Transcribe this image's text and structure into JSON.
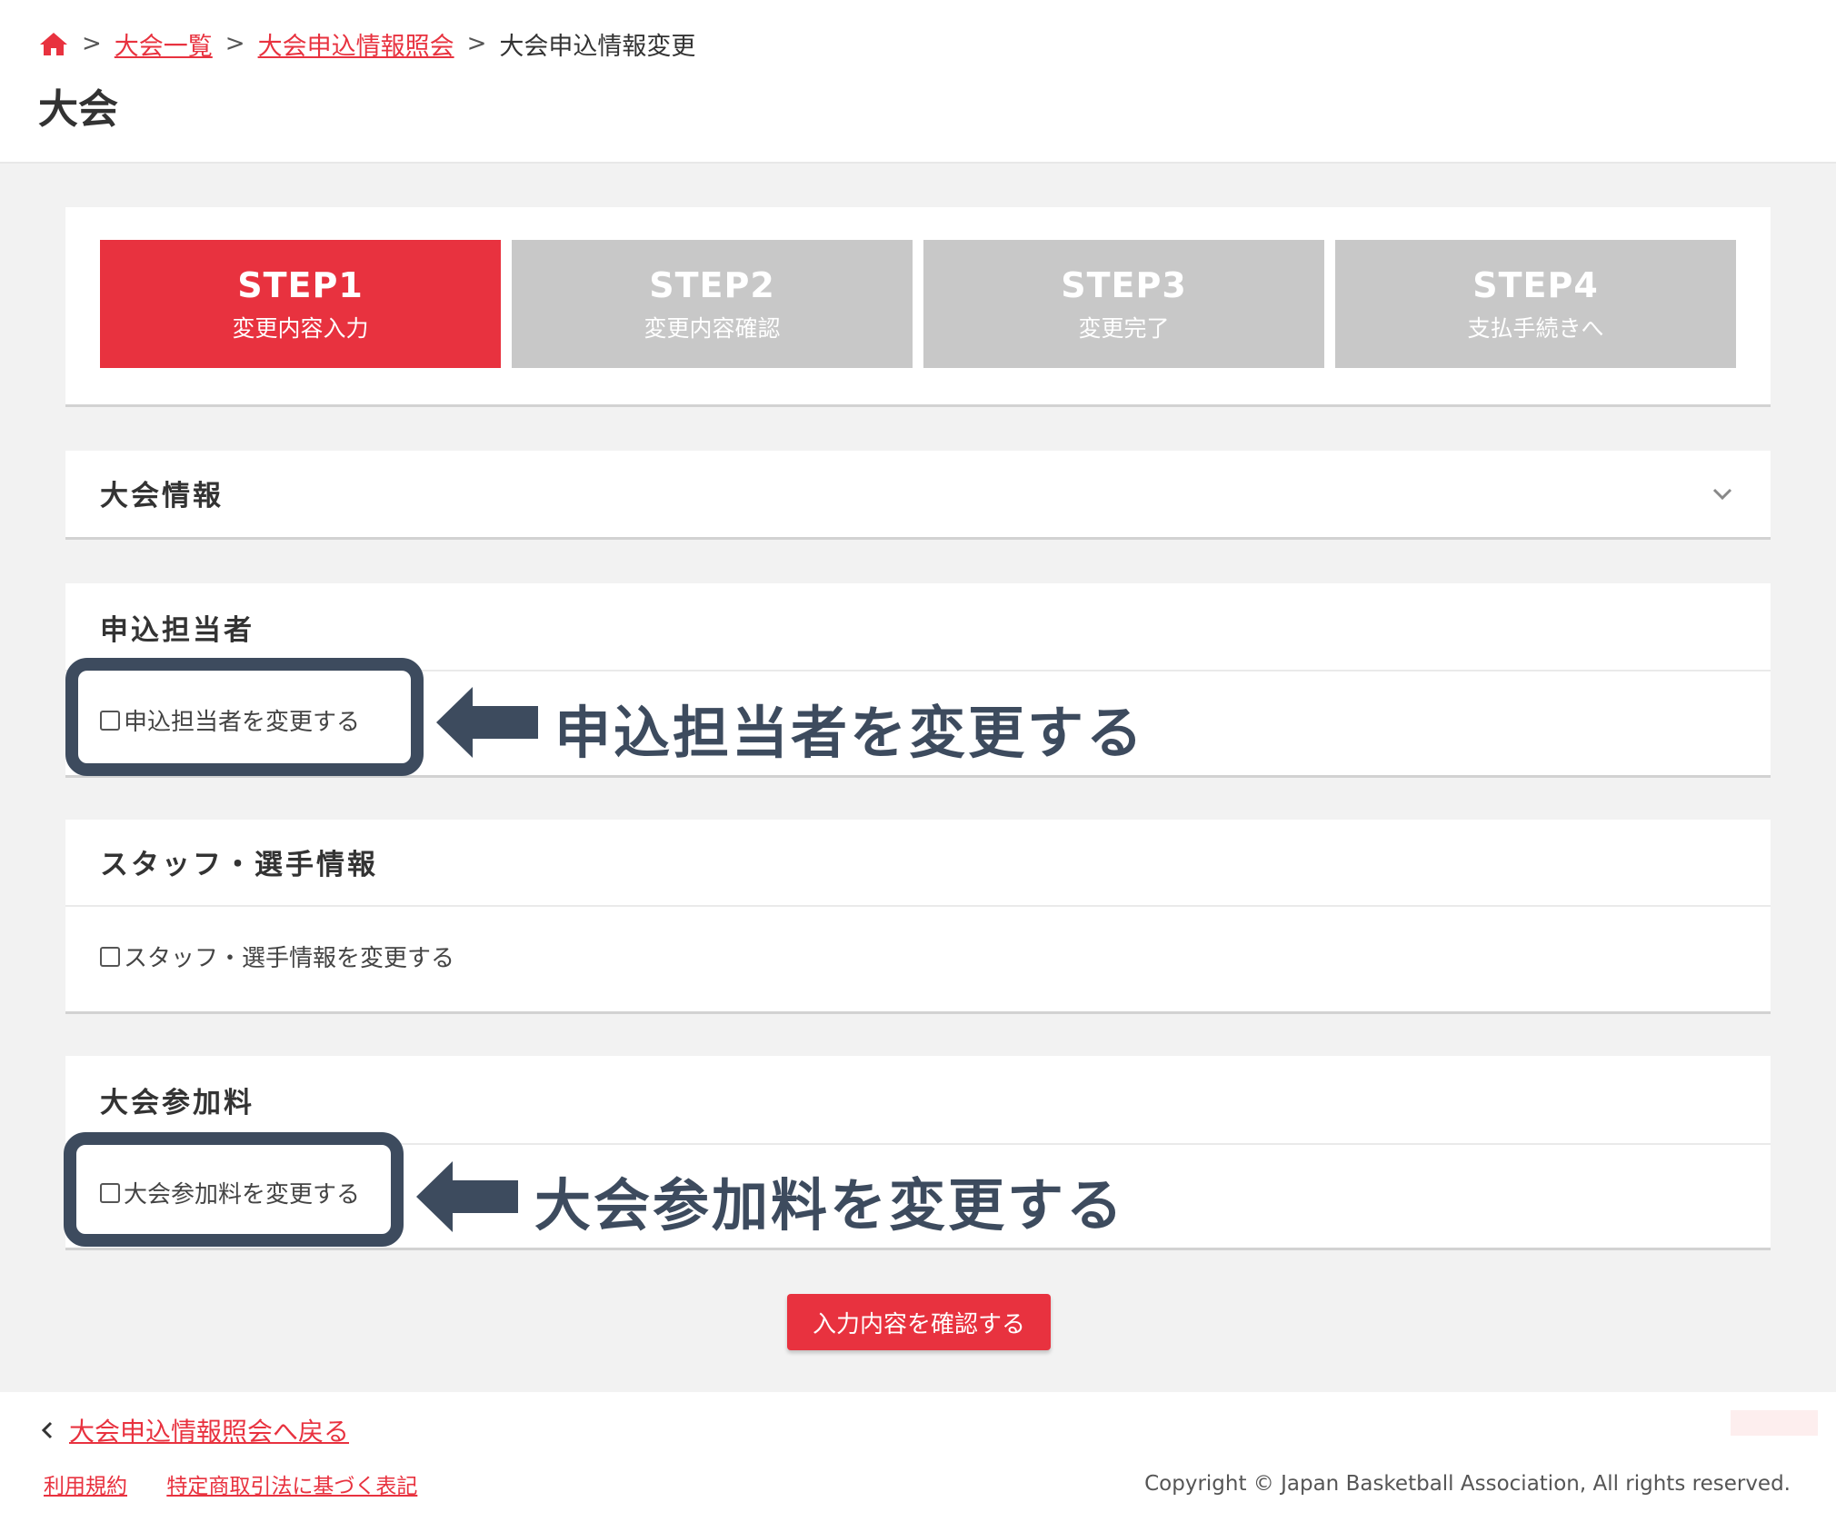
{
  "breadcrumb": {
    "home_icon": "home-icon",
    "items": [
      "大会一覧",
      "大会申込情報照会"
    ],
    "current": "大会申込情報変更",
    "separator": ">"
  },
  "page_title": "大会",
  "steps": [
    {
      "no": "STEP1",
      "label": "変更内容入力",
      "active": true
    },
    {
      "no": "STEP2",
      "label": "変更内容確認",
      "active": false
    },
    {
      "no": "STEP3",
      "label": "変更完了",
      "active": false
    },
    {
      "no": "STEP4",
      "label": "支払手続きへ",
      "active": false
    }
  ],
  "sections": {
    "info": {
      "title": "大会情報",
      "icon": "chevron-down-icon"
    },
    "contact": {
      "title": "申込担当者",
      "checkbox_label": "申込担当者を変更する"
    },
    "staff": {
      "title": "スタッフ・選手情報",
      "checkbox_label": "スタッフ・選手情報を変更する"
    },
    "fee": {
      "title": "大会参加料",
      "checkbox_label": "大会参加料を変更する"
    }
  },
  "callouts": {
    "contact": "申込担当者を変更する",
    "fee": "大会参加料を変更する"
  },
  "confirm_button": "入力内容を確認する",
  "footer": {
    "back_link": "大会申込情報照会へ戻る",
    "links": [
      "利用規約",
      "特定商取引法に基づく表記"
    ],
    "copyright": "Copyright © Japan Basketball Association, All rights reserved."
  },
  "colors": {
    "accent": "#e8323f",
    "step_inactive": "#c8c8c8",
    "callout": "#3d4b5e",
    "background": "#f2f2f2"
  }
}
